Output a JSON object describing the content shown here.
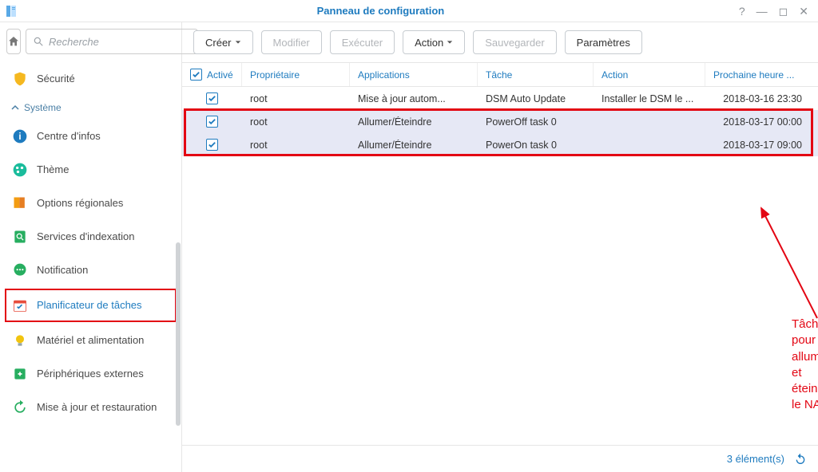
{
  "window": {
    "title": "Panneau de configuration"
  },
  "search": {
    "placeholder": "Recherche"
  },
  "sidebar": {
    "top_item": {
      "label": "Sécurité"
    },
    "section_label": "Système",
    "items": [
      {
        "label": "Centre d'infos",
        "color": "#1e7bbf"
      },
      {
        "label": "Thème",
        "color": "#1abc9c"
      },
      {
        "label": "Options régionales",
        "color": "#f39c12"
      },
      {
        "label": "Services d'indexation",
        "color": "#27ae60"
      },
      {
        "label": "Notification",
        "color": "#27ae60"
      },
      {
        "label": "Planificateur de tâches",
        "color": "#e74c3c",
        "selected": true
      },
      {
        "label": "Matériel et alimentation",
        "color": "#f1c40f"
      },
      {
        "label": "Périphériques externes",
        "color": "#27ae60"
      },
      {
        "label": "Mise à jour et restauration",
        "color": "#27ae60"
      }
    ]
  },
  "toolbar": {
    "create": "Créer",
    "modify": "Modifier",
    "execute": "Exécuter",
    "action": "Action",
    "save": "Sauvegarder",
    "settings": "Paramètres"
  },
  "table": {
    "headers": {
      "active": "Activé",
      "owner": "Propriétaire",
      "applications": "Applications",
      "task": "Tâche",
      "action": "Action",
      "next": "Prochaine heure ..."
    },
    "rows": [
      {
        "active": true,
        "owner": "root",
        "app": "Mise à jour autom...",
        "task": "DSM Auto Update",
        "action": "Installer le DSM le ...",
        "next": "2018-03-16 23:30"
      },
      {
        "active": true,
        "owner": "root",
        "app": "Allumer/Éteindre",
        "task": "PowerOff task 0",
        "action": "",
        "next": "2018-03-17 00:00"
      },
      {
        "active": true,
        "owner": "root",
        "app": "Allumer/Éteindre",
        "task": "PowerOn task 0",
        "action": "",
        "next": "2018-03-17 09:00"
      }
    ]
  },
  "annotation": {
    "line1": "Tâches pour allumer",
    "line2": "et éteindre le NAS"
  },
  "footer": {
    "count_text": "3 élément(s)"
  }
}
